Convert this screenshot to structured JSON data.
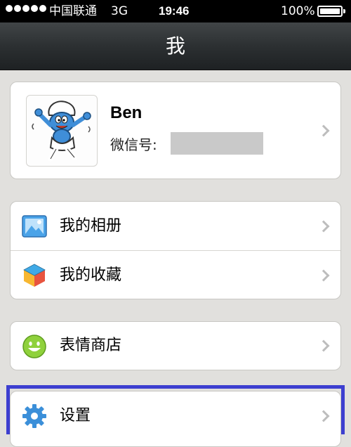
{
  "status_bar": {
    "carrier": "中国联通",
    "network": "3G",
    "time": "19:46",
    "battery_percent": "100%",
    "battery_level": 1.0
  },
  "nav": {
    "title": "我"
  },
  "profile": {
    "name": "Ben",
    "wechat_id_label": "微信号:",
    "avatar_icon": "smurf-avatar"
  },
  "menu": {
    "album": {
      "label": "我的相册",
      "icon": "photo-album-icon"
    },
    "favorites": {
      "label": "我的收藏",
      "icon": "favorites-cube-icon"
    },
    "sticker_store": {
      "label": "表情商店",
      "icon": "smiley-icon"
    },
    "settings": {
      "label": "设置",
      "icon": "gear-icon"
    }
  },
  "colors": {
    "background": "#e1e0dd",
    "highlight": "#3d3fd0",
    "chevron": "#bdbdbd"
  }
}
